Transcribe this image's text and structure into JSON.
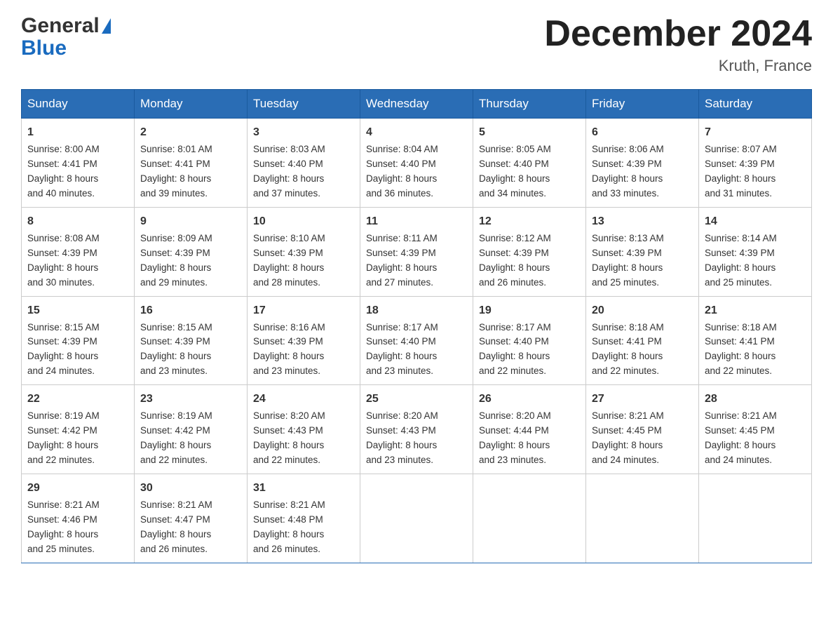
{
  "logo": {
    "general": "General",
    "blue": "Blue"
  },
  "title": "December 2024",
  "location": "Kruth, France",
  "weekdays": [
    "Sunday",
    "Monday",
    "Tuesday",
    "Wednesday",
    "Thursday",
    "Friday",
    "Saturday"
  ],
  "weeks": [
    [
      {
        "day": "1",
        "sunrise": "8:00 AM",
        "sunset": "4:41 PM",
        "daylight": "8 hours and 40 minutes."
      },
      {
        "day": "2",
        "sunrise": "8:01 AM",
        "sunset": "4:41 PM",
        "daylight": "8 hours and 39 minutes."
      },
      {
        "day": "3",
        "sunrise": "8:03 AM",
        "sunset": "4:40 PM",
        "daylight": "8 hours and 37 minutes."
      },
      {
        "day": "4",
        "sunrise": "8:04 AM",
        "sunset": "4:40 PM",
        "daylight": "8 hours and 36 minutes."
      },
      {
        "day": "5",
        "sunrise": "8:05 AM",
        "sunset": "4:40 PM",
        "daylight": "8 hours and 34 minutes."
      },
      {
        "day": "6",
        "sunrise": "8:06 AM",
        "sunset": "4:39 PM",
        "daylight": "8 hours and 33 minutes."
      },
      {
        "day": "7",
        "sunrise": "8:07 AM",
        "sunset": "4:39 PM",
        "daylight": "8 hours and 31 minutes."
      }
    ],
    [
      {
        "day": "8",
        "sunrise": "8:08 AM",
        "sunset": "4:39 PM",
        "daylight": "8 hours and 30 minutes."
      },
      {
        "day": "9",
        "sunrise": "8:09 AM",
        "sunset": "4:39 PM",
        "daylight": "8 hours and 29 minutes."
      },
      {
        "day": "10",
        "sunrise": "8:10 AM",
        "sunset": "4:39 PM",
        "daylight": "8 hours and 28 minutes."
      },
      {
        "day": "11",
        "sunrise": "8:11 AM",
        "sunset": "4:39 PM",
        "daylight": "8 hours and 27 minutes."
      },
      {
        "day": "12",
        "sunrise": "8:12 AM",
        "sunset": "4:39 PM",
        "daylight": "8 hours and 26 minutes."
      },
      {
        "day": "13",
        "sunrise": "8:13 AM",
        "sunset": "4:39 PM",
        "daylight": "8 hours and 25 minutes."
      },
      {
        "day": "14",
        "sunrise": "8:14 AM",
        "sunset": "4:39 PM",
        "daylight": "8 hours and 25 minutes."
      }
    ],
    [
      {
        "day": "15",
        "sunrise": "8:15 AM",
        "sunset": "4:39 PM",
        "daylight": "8 hours and 24 minutes."
      },
      {
        "day": "16",
        "sunrise": "8:15 AM",
        "sunset": "4:39 PM",
        "daylight": "8 hours and 23 minutes."
      },
      {
        "day": "17",
        "sunrise": "8:16 AM",
        "sunset": "4:39 PM",
        "daylight": "8 hours and 23 minutes."
      },
      {
        "day": "18",
        "sunrise": "8:17 AM",
        "sunset": "4:40 PM",
        "daylight": "8 hours and 23 minutes."
      },
      {
        "day": "19",
        "sunrise": "8:17 AM",
        "sunset": "4:40 PM",
        "daylight": "8 hours and 22 minutes."
      },
      {
        "day": "20",
        "sunrise": "8:18 AM",
        "sunset": "4:41 PM",
        "daylight": "8 hours and 22 minutes."
      },
      {
        "day": "21",
        "sunrise": "8:18 AM",
        "sunset": "4:41 PM",
        "daylight": "8 hours and 22 minutes."
      }
    ],
    [
      {
        "day": "22",
        "sunrise": "8:19 AM",
        "sunset": "4:42 PM",
        "daylight": "8 hours and 22 minutes."
      },
      {
        "day": "23",
        "sunrise": "8:19 AM",
        "sunset": "4:42 PM",
        "daylight": "8 hours and 22 minutes."
      },
      {
        "day": "24",
        "sunrise": "8:20 AM",
        "sunset": "4:43 PM",
        "daylight": "8 hours and 22 minutes."
      },
      {
        "day": "25",
        "sunrise": "8:20 AM",
        "sunset": "4:43 PM",
        "daylight": "8 hours and 23 minutes."
      },
      {
        "day": "26",
        "sunrise": "8:20 AM",
        "sunset": "4:44 PM",
        "daylight": "8 hours and 23 minutes."
      },
      {
        "day": "27",
        "sunrise": "8:21 AM",
        "sunset": "4:45 PM",
        "daylight": "8 hours and 24 minutes."
      },
      {
        "day": "28",
        "sunrise": "8:21 AM",
        "sunset": "4:45 PM",
        "daylight": "8 hours and 24 minutes."
      }
    ],
    [
      {
        "day": "29",
        "sunrise": "8:21 AM",
        "sunset": "4:46 PM",
        "daylight": "8 hours and 25 minutes."
      },
      {
        "day": "30",
        "sunrise": "8:21 AM",
        "sunset": "4:47 PM",
        "daylight": "8 hours and 26 minutes."
      },
      {
        "day": "31",
        "sunrise": "8:21 AM",
        "sunset": "4:48 PM",
        "daylight": "8 hours and 26 minutes."
      },
      null,
      null,
      null,
      null
    ]
  ],
  "labels": {
    "sunrise": "Sunrise:",
    "sunset": "Sunset:",
    "daylight": "Daylight:"
  }
}
